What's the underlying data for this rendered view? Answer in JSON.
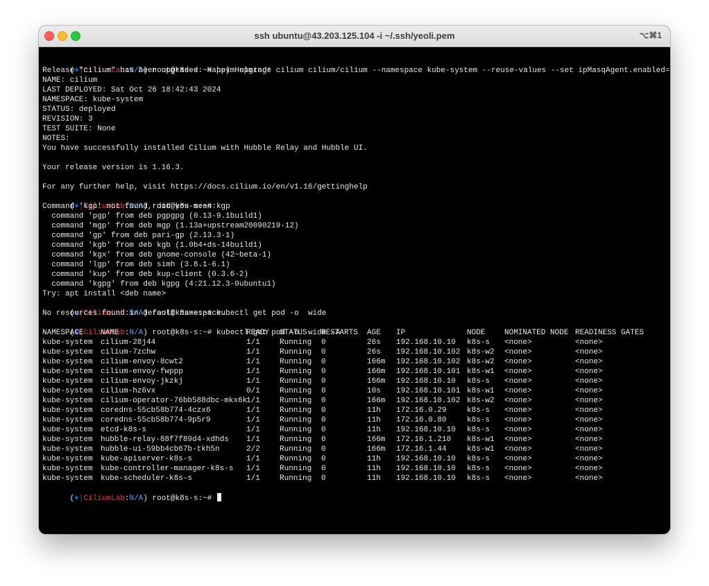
{
  "window": {
    "title": "ssh ubuntu@43.203.125.104 -i ~/.ssh/yeoli.pem",
    "shortcut": "⌥⌘1"
  },
  "prompt": {
    "symbol": "⎈",
    "pipe": "|",
    "context": "CiliumLab",
    "namespace": "N/A",
    "user_host": "root@k8s-s:~#"
  },
  "block1": {
    "command": "helm upgrade cilium cilium/cilium --namespace kube-system --reuse-values --set ipMasqAgent.enabled=true",
    "output": [
      "Release \"cilium\" has been upgraded. Happy Helming!",
      "NAME: cilium",
      "LAST DEPLOYED: Sat Oct 26 18:42:43 2024",
      "NAMESPACE: kube-system",
      "STATUS: deployed",
      "REVISION: 3",
      "TEST SUITE: None",
      "NOTES:",
      "You have successfully installed Cilium with Hubble Relay and Hubble UI.",
      "",
      "Your release version is 1.16.3.",
      "",
      "For any further help, visit https://docs.cilium.io/en/v1.16/gettinghelp"
    ]
  },
  "block2": {
    "command": "kgp",
    "output": [
      "Command 'kgp' not found, did you mean:",
      "  command 'pgp' from deb pgpgpg (0.13-9.1build1)",
      "  command 'mgp' from deb mgp (1.13a+upstream20090219-12)",
      "  command 'gp' from deb pari-gp (2.13.3-1)",
      "  command 'kgb' from deb kgb (1.0b4+ds-14build1)",
      "  command 'kgx' from deb gnome-console (42~beta-1)",
      "  command 'lgp' from deb simh (3.8.1-6.1)",
      "  command 'kup' from deb kup-client (0.3.6-2)",
      "  command 'kgpg' from deb kgpg (4:21.12.3-0ubuntu1)",
      "Try: apt install <deb name>"
    ]
  },
  "block3": {
    "command": "kubectl get pod -o  wide",
    "output": [
      "No resources found in default namespace."
    ]
  },
  "block4": {
    "command": "kubectl get pod -o  wide -A"
  },
  "pods_table": {
    "headers": [
      "NAMESPACE",
      "NAME",
      "READY",
      "STATUS",
      "RESTARTS",
      "AGE",
      "IP",
      "NODE",
      "NOMINATED NODE",
      "READINESS GATES"
    ],
    "rows": [
      [
        "kube-system",
        "cilium-28j44",
        "1/1",
        "Running",
        "0",
        "26s",
        "192.168.10.10",
        "k8s-s",
        "<none>",
        "<none>"
      ],
      [
        "kube-system",
        "cilium-7zchw",
        "1/1",
        "Running",
        "0",
        "26s",
        "192.168.10.102",
        "k8s-w2",
        "<none>",
        "<none>"
      ],
      [
        "kube-system",
        "cilium-envoy-8cwt2",
        "1/1",
        "Running",
        "0",
        "166m",
        "192.168.10.102",
        "k8s-w2",
        "<none>",
        "<none>"
      ],
      [
        "kube-system",
        "cilium-envoy-fwppp",
        "1/1",
        "Running",
        "0",
        "166m",
        "192.168.10.101",
        "k8s-w1",
        "<none>",
        "<none>"
      ],
      [
        "kube-system",
        "cilium-envoy-jkzkj",
        "1/1",
        "Running",
        "0",
        "166m",
        "192.168.10.10",
        "k8s-s",
        "<none>",
        "<none>"
      ],
      [
        "kube-system",
        "cilium-hz6vx",
        "0/1",
        "Running",
        "0",
        "10s",
        "192.168.10.101",
        "k8s-w1",
        "<none>",
        "<none>"
      ],
      [
        "kube-system",
        "cilium-operator-76bb588dbc-mkx6k",
        "1/1",
        "Running",
        "0",
        "166m",
        "192.168.10.102",
        "k8s-w2",
        "<none>",
        "<none>"
      ],
      [
        "kube-system",
        "coredns-55cb58b774-4czx6",
        "1/1",
        "Running",
        "0",
        "11h",
        "172.16.0.29",
        "k8s-s",
        "<none>",
        "<none>"
      ],
      [
        "kube-system",
        "coredns-55cb58b774-9p5r9",
        "1/1",
        "Running",
        "0",
        "11h",
        "172.16.0.80",
        "k8s-s",
        "<none>",
        "<none>"
      ],
      [
        "kube-system",
        "etcd-k8s-s",
        "1/1",
        "Running",
        "0",
        "11h",
        "192.168.10.10",
        "k8s-s",
        "<none>",
        "<none>"
      ],
      [
        "kube-system",
        "hubble-relay-88f7f89d4-xdhds",
        "1/1",
        "Running",
        "0",
        "166m",
        "172.16.1.210",
        "k8s-w1",
        "<none>",
        "<none>"
      ],
      [
        "kube-system",
        "hubble-ui-59bb4cb67b-tkh5n",
        "2/2",
        "Running",
        "0",
        "166m",
        "172.16.1.44",
        "k8s-w1",
        "<none>",
        "<none>"
      ],
      [
        "kube-system",
        "kube-apiserver-k8s-s",
        "1/1",
        "Running",
        "0",
        "11h",
        "192.168.10.10",
        "k8s-s",
        "<none>",
        "<none>"
      ],
      [
        "kube-system",
        "kube-controller-manager-k8s-s",
        "1/1",
        "Running",
        "0",
        "11h",
        "192.168.10.10",
        "k8s-s",
        "<none>",
        "<none>"
      ],
      [
        "kube-system",
        "kube-scheduler-k8s-s",
        "1/1",
        "Running",
        "0",
        "11h",
        "192.168.10.10",
        "k8s-s",
        "<none>",
        "<none>"
      ]
    ]
  }
}
